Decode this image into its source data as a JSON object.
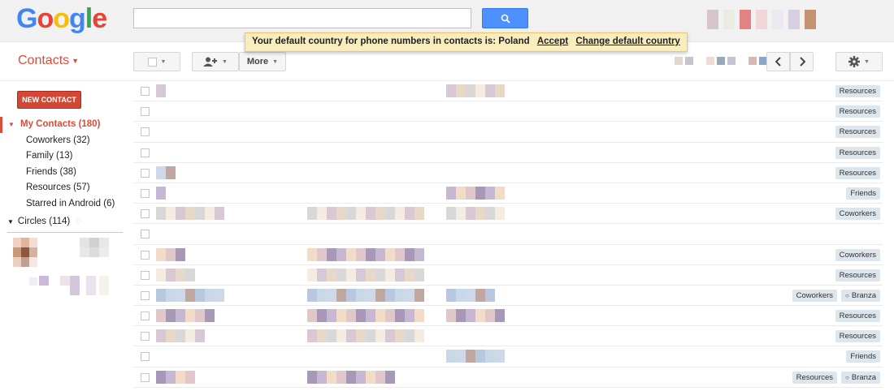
{
  "header": {
    "logo_text": "Google",
    "search": {
      "value": "",
      "placeholder": ""
    },
    "search_icon": "magnifier-icon"
  },
  "notice": {
    "message": "Your default country for phone numbers in contacts is: Poland",
    "accept": "Accept",
    "change": "Change default country"
  },
  "app": {
    "title": "Contacts"
  },
  "toolbar": {
    "more_label": "More",
    "icons": [
      "checkbox-icon",
      "add-person-icon",
      "chevron-left-icon",
      "chevron-right-icon",
      "gear-icon"
    ]
  },
  "sidebar": {
    "new_contact": "NEW CONTACT",
    "my_contacts": "My Contacts (180)",
    "groups": [
      {
        "label": "Coworkers (32)"
      },
      {
        "label": "Family (13)"
      },
      {
        "label": "Friends (38)"
      },
      {
        "label": "Resources (57)"
      },
      {
        "label": "Starred in Android (6)"
      }
    ],
    "circles": "Circles (114)"
  },
  "contacts": [
    {
      "labels": [
        "Resources"
      ]
    },
    {
      "labels": [
        "Resources"
      ]
    },
    {
      "labels": [
        "Resources"
      ]
    },
    {
      "labels": [
        "Resources"
      ]
    },
    {
      "labels": [
        "Resources"
      ]
    },
    {
      "labels": [
        "Friends"
      ]
    },
    {
      "labels": [
        "Coworkers"
      ]
    },
    {
      "labels": []
    },
    {
      "labels": [
        "Coworkers"
      ]
    },
    {
      "labels": [
        "Resources"
      ]
    },
    {
      "labels": [
        "Coworkers",
        "Branza"
      ]
    },
    {
      "labels": [
        "Resources"
      ]
    },
    {
      "labels": [
        "Resources"
      ]
    },
    {
      "labels": [
        "Friends"
      ]
    },
    {
      "labels": [
        "Resources",
        "Branza"
      ]
    }
  ],
  "colors": {
    "accent": "#dd4b39",
    "search_blue": "#4d90fe",
    "notice_bg": "#f9edbe"
  }
}
